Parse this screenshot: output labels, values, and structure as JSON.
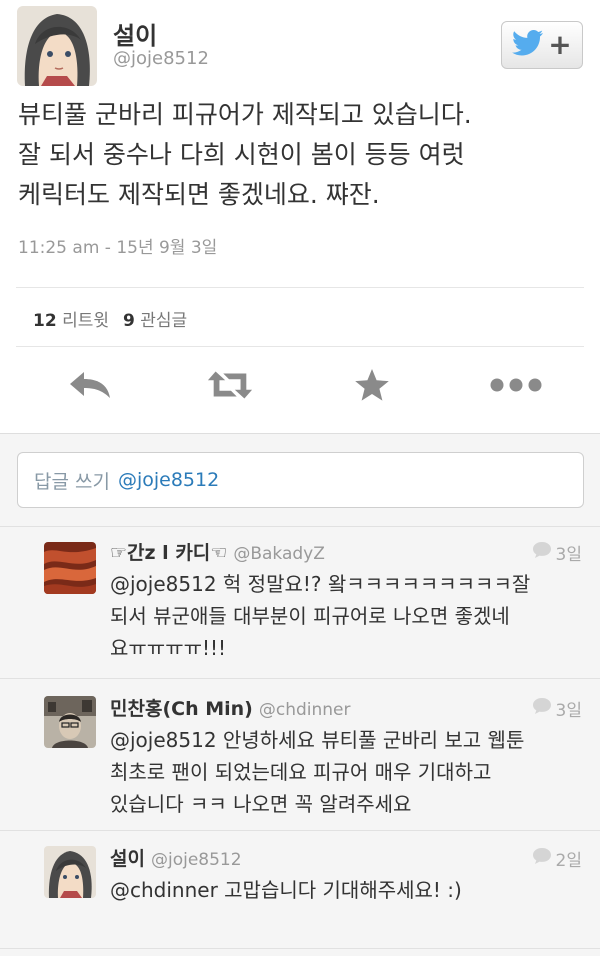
{
  "tweet": {
    "author_name": "설이",
    "author_handle": "@joje8512",
    "text_lines": [
      "뷰티풀 군바리 피규어가 제작되고 있습니다.",
      "잘 되서 중수나 다희 시현이 봄이 등등 여럿",
      "케릭터도 제작되면 좋겠네요. 쨔잔."
    ],
    "timestamp": "11:25 am - 15년 9월 3일",
    "retweet_count": "12",
    "retweet_label": "리트윗",
    "favorite_count": "9",
    "favorite_label": "관심글"
  },
  "actions": [
    "reply-icon",
    "retweet-icon",
    "favorite-star-icon",
    "more-icon"
  ],
  "reply_box": {
    "placeholder": "답글 쓰기",
    "handle": "@joje8512"
  },
  "replies": [
    {
      "name": "☞간z l 카디☜",
      "handle": "@BakadyZ",
      "time": "3일",
      "lines": [
        "@joje8512 헉 정말요!? 왘ㅋㅋㅋㅋㅋㅋㅋㅋㅋ잘",
        "되서 뷰군애들 대부분이 피규어로 나오면 좋겠네",
        "요ㅠㅠㅠㅠ!!!"
      ]
    },
    {
      "name": "민찬홍(Ch Min)",
      "handle": "@chdinner",
      "time": "3일",
      "lines": [
        "@joje8512 안녕하세요 뷰티풀 군바리 보고 웹툰",
        "최초로 팬이 되었는데요 피규어 매우 기대하고",
        "있습니다 ㅋㅋ 나오면 꼭 알려주세요"
      ]
    },
    {
      "name": "설이",
      "handle": "@joje8512",
      "time": "2일",
      "lines": [
        "@chdinner 고맙습니다 기대해주세요! :)"
      ]
    }
  ],
  "colors": {
    "twitter_blue": "#55acee",
    "link_blue": "#2b7bb9",
    "icon_gray": "#8a8a8a"
  }
}
